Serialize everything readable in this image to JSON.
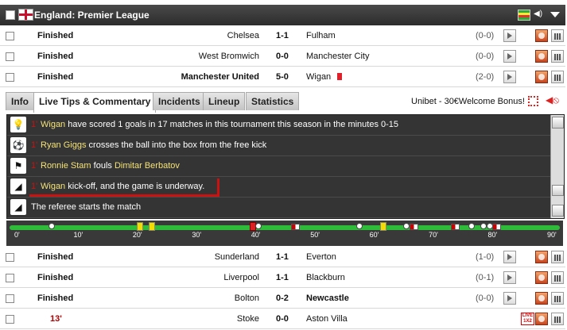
{
  "league": {
    "title": "England: Premier League"
  },
  "matches_top": [
    {
      "status": "Finished",
      "home": "Chelsea",
      "score": "1-1",
      "away": "Fulham",
      "ht": "(0-0)",
      "home_bold": false,
      "away_bold": false,
      "red_card": false
    },
    {
      "status": "Finished",
      "home": "West Bromwich",
      "score": "0-0",
      "away": "Manchester City",
      "ht": "(0-0)",
      "home_bold": false,
      "away_bold": false,
      "red_card": false
    },
    {
      "status": "Finished",
      "home": "Manchester United",
      "score": "5-0",
      "away": "Wigan",
      "ht": "(2-0)",
      "home_bold": true,
      "away_bold": false,
      "red_card": true
    }
  ],
  "tabs": [
    "Info",
    "Live Tips & Commentary",
    "Incidents",
    "Lineup",
    "Statistics"
  ],
  "active_tab": "Live Tips & Commentary",
  "bonus_text": "Unibet - 30€Welcome Bonus!",
  "commentary": [
    {
      "icon": "lightbulb-icon",
      "minute": "1'",
      "parts": [
        [
          "Wigan",
          true
        ],
        [
          " have scored 1 goals in 17 matches in this tournament this season in the minutes 0-15",
          false
        ]
      ]
    },
    {
      "icon": "free-kick-icon",
      "minute": "1'",
      "parts": [
        [
          "Ryan Giggs",
          true
        ],
        [
          " crosses the ball into the box from the free kick",
          false
        ]
      ]
    },
    {
      "icon": "foul-icon",
      "minute": "1'",
      "parts": [
        [
          "Ronnie Stam",
          true
        ],
        [
          " fouls ",
          false
        ],
        [
          "Dimitar Berbatov",
          true
        ]
      ]
    },
    {
      "icon": "whistle-icon",
      "minute": "1'",
      "parts": [
        [
          "Wigan",
          true
        ],
        [
          " kick-off, and the game is underway.",
          false
        ]
      ]
    },
    {
      "icon": "whistle-icon",
      "minute": "",
      "parts": [
        [
          "The referee starts the match",
          false
        ]
      ]
    }
  ],
  "timeline": {
    "ticks": [
      "0'",
      "10'",
      "20'",
      "30'",
      "40'",
      "50'",
      "60'",
      "70'",
      "80'",
      "90'"
    ],
    "events": [
      {
        "type": "goal",
        "minute": 6
      },
      {
        "type": "yellow",
        "minute": 21
      },
      {
        "type": "yellow",
        "minute": 23
      },
      {
        "type": "red",
        "minute": 40
      },
      {
        "type": "goal",
        "minute": 41
      },
      {
        "type": "sub",
        "minute": 47
      },
      {
        "type": "goal",
        "minute": 58
      },
      {
        "type": "yellow",
        "minute": 62
      },
      {
        "type": "goal",
        "minute": 66
      },
      {
        "type": "sub",
        "minute": 67
      },
      {
        "type": "sub",
        "minute": 74
      },
      {
        "type": "goal",
        "minute": 77
      },
      {
        "type": "goal",
        "minute": 79
      },
      {
        "type": "penalty",
        "minute": 80
      },
      {
        "type": "sub",
        "minute": 81
      }
    ]
  },
  "matches_bottom": [
    {
      "status": "Finished",
      "home": "Sunderland",
      "score": "1-1",
      "away": "Everton",
      "ht": "(1-0)",
      "home_bold": false,
      "away_bold": false,
      "live": false
    },
    {
      "status": "Finished",
      "home": "Liverpool",
      "score": "1-1",
      "away": "Blackburn",
      "ht": "(0-1)",
      "home_bold": false,
      "away_bold": false,
      "live": false
    },
    {
      "status": "Finished",
      "home": "Bolton",
      "score": "0-2",
      "away": "Newcastle",
      "ht": "(0-0)",
      "home_bold": false,
      "away_bold": true,
      "live": false
    },
    {
      "status": "13'",
      "home": "Stoke",
      "score": "0-0",
      "away": "Aston Villa",
      "ht": "",
      "home_bold": false,
      "away_bold": false,
      "live": true
    }
  ],
  "live_icon_text": "LIVE 1X2"
}
